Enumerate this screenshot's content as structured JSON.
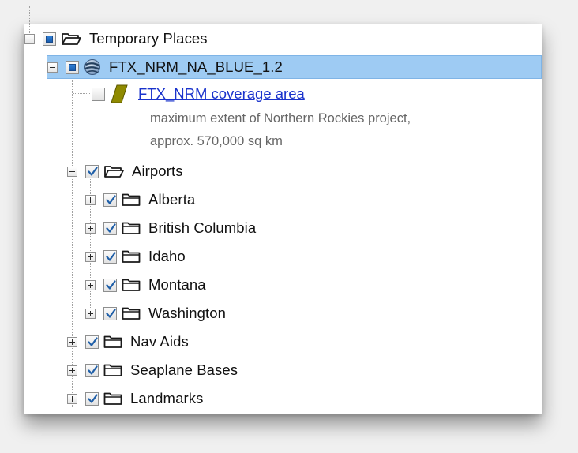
{
  "tree": {
    "root": {
      "label": "Temporary Places",
      "state": "partial",
      "expanded": true,
      "icon": "open-folder-icon"
    },
    "layer": {
      "label": "FTX_NRM_NA_BLUE_1.2",
      "state": "partial",
      "expanded": true,
      "selected": true,
      "icon": "globe-icon"
    },
    "coverage": {
      "link_label": "FTX_NRM coverage area",
      "description_line1": "maximum extent of Northern Rockies project,",
      "description_line2": "approx. 570,000 sq km",
      "state": "unchecked",
      "icon": "polygon-icon",
      "polygon_color": "#8f8a00"
    },
    "airports": {
      "label": "Airports",
      "state": "checked",
      "expanded": true,
      "icon": "open-folder-icon",
      "children": [
        {
          "label": "Alberta"
        },
        {
          "label": "British Columbia"
        },
        {
          "label": "Idaho"
        },
        {
          "label": "Montana"
        },
        {
          "label": "Washington"
        }
      ]
    },
    "folders": [
      {
        "label": "Nav Aids"
      },
      {
        "label": "Seaplane Bases"
      },
      {
        "label": "Landmarks"
      }
    ]
  },
  "colors": {
    "selection": "#9ecbf3",
    "link": "#1a33cc",
    "check": "#1f5fa8"
  }
}
